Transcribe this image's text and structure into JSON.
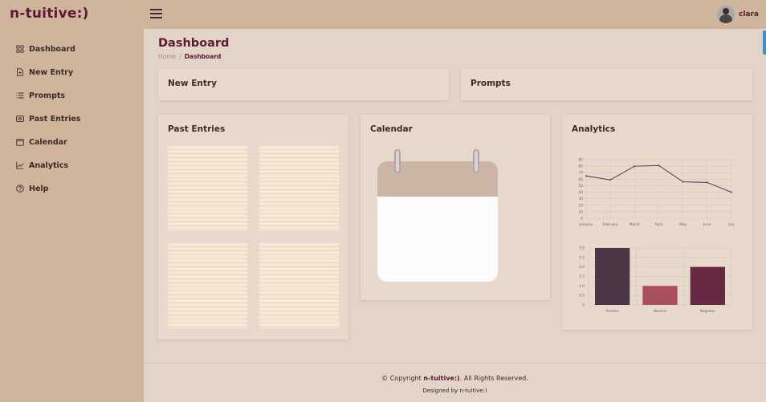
{
  "app": {
    "logo": "n-tuitive:)"
  },
  "header": {
    "user_name": "clara"
  },
  "sidebar": {
    "items": [
      {
        "label": "Dashboard",
        "icon": "grid-icon"
      },
      {
        "label": "New Entry",
        "icon": "file-plus-icon"
      },
      {
        "label": "Prompts",
        "icon": "list-icon"
      },
      {
        "label": "Past Entries",
        "icon": "card-icon"
      },
      {
        "label": "Calendar",
        "icon": "calendar-icon"
      },
      {
        "label": "Analytics",
        "icon": "chart-icon"
      },
      {
        "label": "Help",
        "icon": "help-icon"
      }
    ]
  },
  "page": {
    "title": "Dashboard",
    "breadcrumb": {
      "home": "Home",
      "separator": "/",
      "current": "Dashboard"
    }
  },
  "cards": {
    "new_entry": "New Entry",
    "prompts": "Prompts",
    "past_entries": "Past Entries",
    "calendar": "Calendar",
    "analytics": "Analytics"
  },
  "colors": {
    "brand": "#5e1834",
    "line": "#6b3f5d",
    "bar_positive": "#4a3848",
    "bar_neutral": "#a8505f",
    "bar_negative": "#682942"
  },
  "footer": {
    "copyright_prefix": "© Copyright",
    "brand": "n-tuitive:)",
    "copyright_suffix": ". All Rights Reserved.",
    "designed_by": "Designed by n-tuitive:)"
  },
  "chart_data": [
    {
      "type": "line",
      "categories": [
        "January",
        "February",
        "March",
        "April",
        "May",
        "June",
        "July"
      ],
      "values": [
        65,
        59,
        80,
        81,
        56,
        55,
        40
      ],
      "yticks": [
        "0",
        "10",
        "20",
        "30",
        "40",
        "50",
        "60",
        "70",
        "80",
        "90"
      ],
      "ylim": [
        0,
        90
      ],
      "grid": true
    },
    {
      "type": "bar",
      "categories": [
        "Positive",
        "Neutral",
        "Negative"
      ],
      "values": [
        3.0,
        1.0,
        2.0
      ],
      "yticks": [
        "0",
        "0.5",
        "1.0",
        "1.5",
        "2.0",
        "2.5",
        "3.0"
      ],
      "ylim": [
        0,
        3.0
      ],
      "grid": true
    }
  ]
}
